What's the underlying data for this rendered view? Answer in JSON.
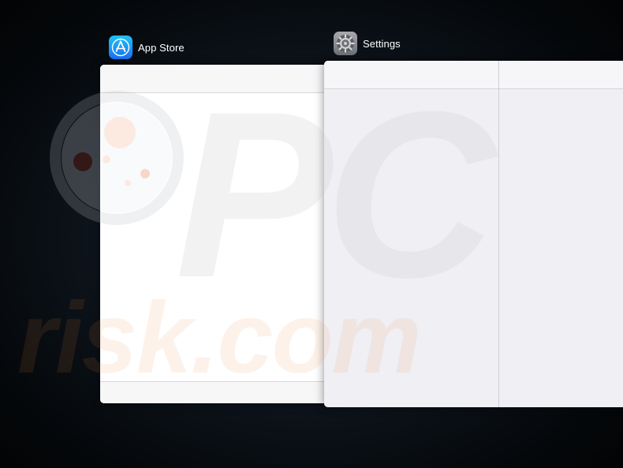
{
  "switcher": {
    "apps": [
      {
        "name": "App Store",
        "icon": "app-store-icon"
      },
      {
        "name": "Settings",
        "icon": "settings-gear-icon"
      }
    ]
  },
  "watermark": {
    "text": "risk.com",
    "logo": "PC"
  },
  "colors": {
    "appstore_icon_top": "#1fc2fb",
    "appstore_icon_bottom": "#1a6ff0",
    "settings_icon": "#8e9094",
    "watermark_orange": "#f08a3a",
    "watermark_gray": "#c8c8cc"
  }
}
